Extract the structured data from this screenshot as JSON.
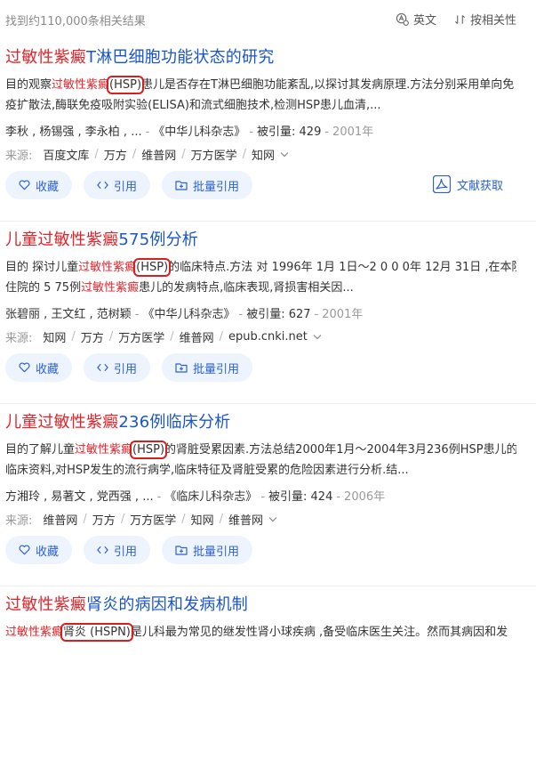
{
  "header": {
    "result_count": "找到约110,000条相关结果",
    "language_label": "英文",
    "sort_label": "按相关性"
  },
  "results": [
    {
      "title_highlight": "过敏性紫癜",
      "title_rest": "T淋巴细胞功能状态的研究",
      "abs1_pre": "目的观察",
      "abs1_hl": "过敏性紫癜",
      "abs1_box": "(HSP)",
      "abs1_post": "患儿是否存在T淋巴细胞功能紊乱,以探讨其发病原理.方法分别采用单向免",
      "abs2_pre": "疫扩散法,酶联免疫吸附实验(ELISA)和流式细胞技术,检测HSP患儿血清,...",
      "abs2_hl": "",
      "abs2_post": "",
      "authors": "李秋 , 杨锡强 , 李永柏 , ...",
      "journal": "《中华儿科杂志》",
      "citations": "被引量: 429",
      "year": "2001年",
      "source_label": "来源:",
      "sources": [
        "百度文库",
        "万方",
        "维普网",
        "万方医学",
        "知网"
      ],
      "actions": [
        "收藏",
        "引用",
        "批量引用"
      ],
      "fetch_label": "文献获取"
    },
    {
      "title_highlight": "儿童过敏性紫癜",
      "title_rest": "575例分析",
      "abs1_pre": "目的 探讨儿童",
      "abs1_hl": "过敏性紫癜",
      "abs1_box": "(HSP)",
      "abs1_post": "的临床特点.方法 对 1996年 1月 1日～2 0 0 0年 12月 31日 ,在本院",
      "abs2_pre": "住院的 5 75例",
      "abs2_hl": "过敏性紫癜",
      "abs2_post": "患儿的发病特点,临床表现,肾损害相关因...",
      "authors": "张碧丽 , 王文红 , 范树颖",
      "journal": "《中华儿科杂志》",
      "citations": "被引量: 627",
      "year": "2001年",
      "source_label": "来源:",
      "sources": [
        "知网",
        "万方",
        "万方医学",
        "维普网",
        "epub.cnki.net"
      ],
      "actions": [
        "收藏",
        "引用",
        "批量引用"
      ],
      "fetch_label": ""
    },
    {
      "title_highlight": "儿童过敏性紫癜",
      "title_rest": "236例临床分析",
      "abs1_pre": "目的了解儿童",
      "abs1_hl": "过敏性紫癜",
      "abs1_box": "(HSP)",
      "abs1_post": "的肾脏受累因素.方法总结2000年1月～2004年3月236例HSP患儿的",
      "abs2_pre": "临床资料,对HSP发生的流行病学,临床特征及肾脏受累的危险因素进行分析.结...",
      "abs2_hl": "",
      "abs2_post": "",
      "authors": "方湘玲 , 易著文 , 党西强 , ...",
      "journal": "《临床儿科杂志》",
      "citations": "被引量: 424",
      "year": "2006年",
      "source_label": "来源:",
      "sources": [
        "维普网",
        "万方",
        "万方医学",
        "知网",
        "维普网"
      ],
      "actions": [
        "收藏",
        "引用",
        "批量引用"
      ],
      "fetch_label": ""
    },
    {
      "title_highlight": "过敏性紫癜",
      "title_rest": "肾炎的病因和发病机制",
      "abs1_pre": "",
      "abs1_hl": "过敏性紫癜",
      "abs1_box": "肾炎 (HSPN)",
      "abs1_post": "是儿科最为常见的继发性肾小球疾病 ,备受临床医生关注。然而其病因和发",
      "abs2_pre": "",
      "abs2_hl": "",
      "abs2_post": "",
      "authors": "",
      "journal": "",
      "citations": "",
      "year": "",
      "source_label": "",
      "sources": [],
      "actions": [],
      "fetch_label": ""
    }
  ],
  "colors": {
    "title": "#1a56c8",
    "highlight": "#e0242b",
    "button_bg": "#eef4fe",
    "button_text": "#2b62cf",
    "annotation_box": "#d81f1f"
  },
  "icons": {
    "language": "translate-icon",
    "sort": "sort-icon",
    "favorite": "heart-icon",
    "cite": "code-brackets-icon",
    "batch_cite": "folder-plus-icon",
    "fetch": "pdf-icon",
    "expand": "chevron-down-icon"
  }
}
